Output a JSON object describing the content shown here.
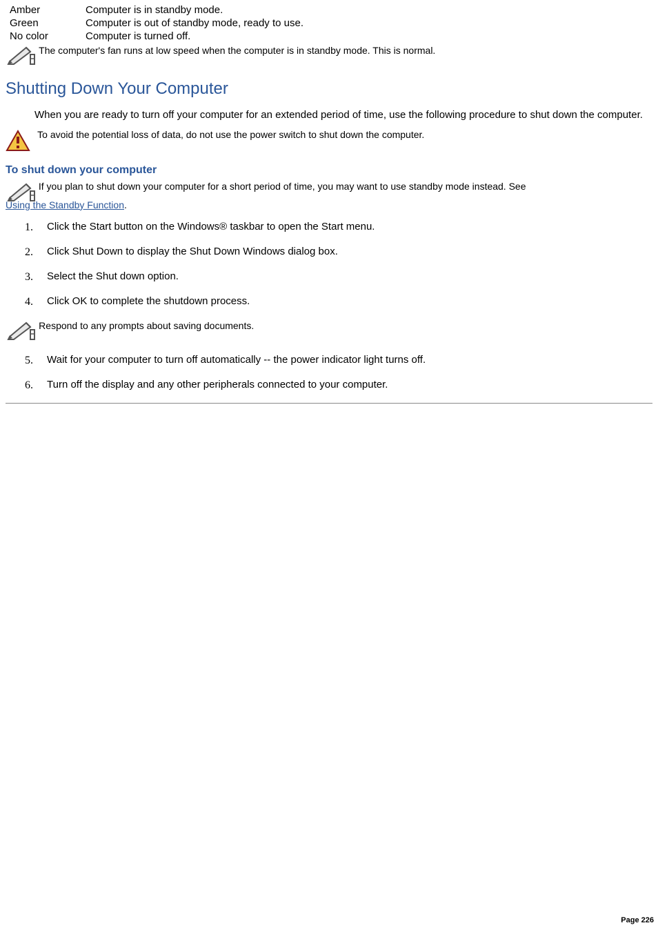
{
  "status_table": [
    {
      "color": "Amber",
      "meaning": "Computer is in standby mode."
    },
    {
      "color": "Green",
      "meaning": "Computer is out of standby mode, ready to use."
    },
    {
      "color": "No color",
      "meaning": "Computer is turned off."
    }
  ],
  "fan_note": "The computer's fan runs at low speed when the computer is in standby mode. This is normal.",
  "heading": "Shutting Down Your Computer",
  "intro": "When you are ready to turn off your computer for an extended period of time, use the following procedure to shut down the computer.",
  "caution": "To avoid the potential loss of data, do not use the power switch to shut down the computer.",
  "subheading": "To shut down your computer",
  "shutdown_note": {
    "pre": "If you plan to shut down your computer for a short period of time, you may want to use standby mode instead. See ",
    "link": "Using the Standby Function",
    "post": "."
  },
  "steps14": [
    "Click the Start button on the Windows® taskbar to open the Start menu.",
    "Click Shut Down to display the Shut Down Windows dialog box.",
    "Select the Shut down option.",
    "Click OK to complete the shutdown process."
  ],
  "respond_note": "Respond to any prompts about saving documents.",
  "steps56": [
    "Wait for your computer to turn off automatically -- the power indicator light turns off.",
    "Turn off the display and any other peripherals connected to your computer."
  ],
  "page_label": "Page 226"
}
